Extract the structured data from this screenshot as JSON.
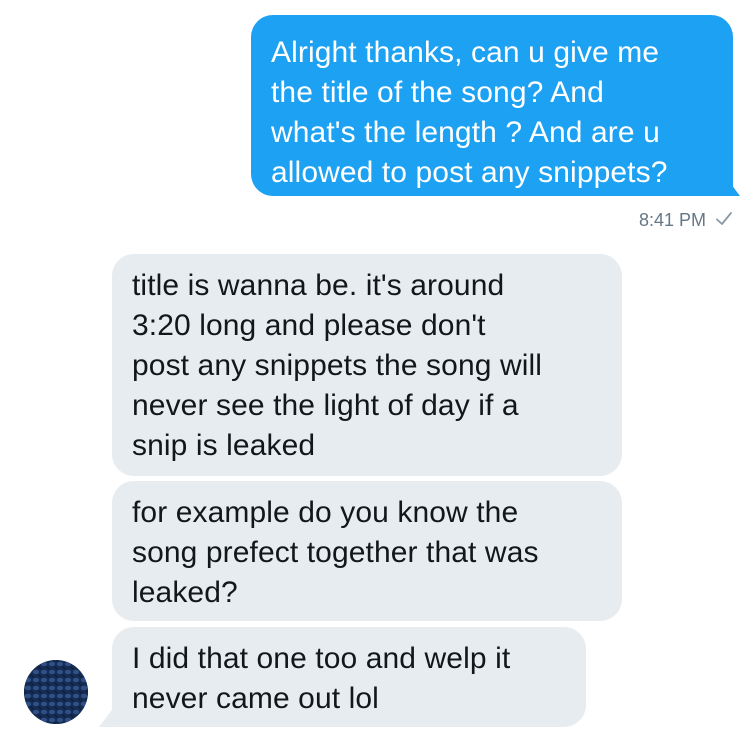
{
  "conversation": {
    "messages": [
      {
        "direction": "sent",
        "text": "Alright thanks, can u give me\nthe title of the song? And\nwhat's the length ? And are u\nallowed to post any snippets?"
      },
      {
        "direction": "received",
        "text": "title is wanna be. it's around\n3:20 long and please don't\npost any snippets the song will\nnever see the light of day if a\nsnip is leaked"
      },
      {
        "direction": "received",
        "text": "for example do you know the\nsong prefect together that was\nleaked?"
      },
      {
        "direction": "received",
        "text": "I did that one too and welp it\nnever came out lol"
      }
    ],
    "sent_timestamp": "8:41 PM",
    "sent_status_icon": "checkmark-icon",
    "avatar_icon": "avatar-icon",
    "colors": {
      "sent_bubble": "#1da1f2",
      "received_bubble": "#e6ecf0",
      "timestamp": "#657786"
    }
  }
}
